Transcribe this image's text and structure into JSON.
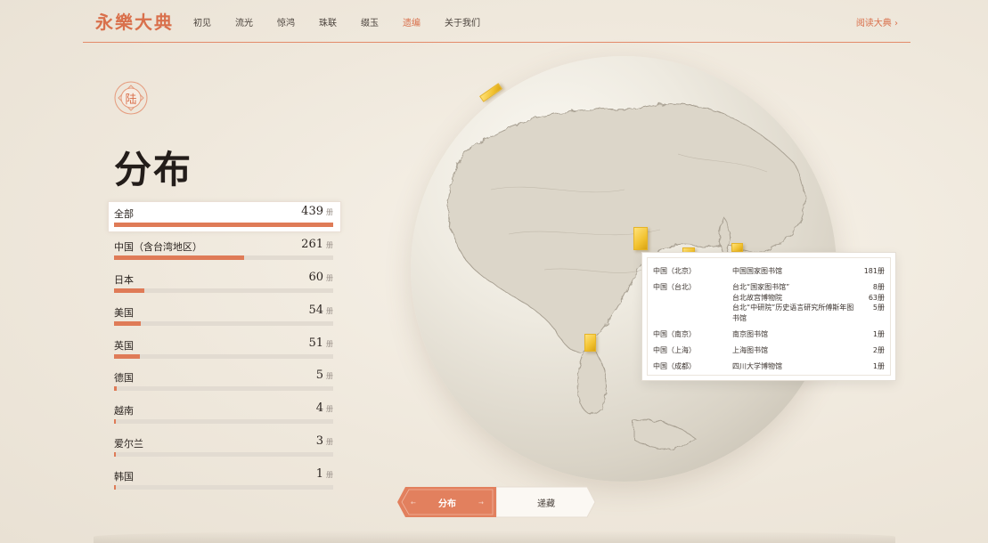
{
  "header": {
    "logo": "永樂大典",
    "nav": [
      {
        "label": "初见",
        "active": false
      },
      {
        "label": "流光",
        "active": false
      },
      {
        "label": "惊鸿",
        "active": false
      },
      {
        "label": "珠联",
        "active": false
      },
      {
        "label": "缀玉",
        "active": false
      },
      {
        "label": "遗编",
        "active": true
      },
      {
        "label": "关于我们",
        "active": false
      }
    ],
    "read_link": "阅读大典 ›"
  },
  "badge": "陆",
  "section_title": "分布",
  "unit": "册",
  "distribution": [
    {
      "name": "全部",
      "count": 439,
      "fraction": 1.0,
      "selected": true
    },
    {
      "name": "中国（含台湾地区）",
      "count": 261,
      "fraction": 0.5945,
      "selected": false
    },
    {
      "name": "日本",
      "count": 60,
      "fraction": 0.1367,
      "selected": false
    },
    {
      "name": "美国",
      "count": 54,
      "fraction": 0.123,
      "selected": false
    },
    {
      "name": "英国",
      "count": 51,
      "fraction": 0.1162,
      "selected": false
    },
    {
      "name": "德国",
      "count": 5,
      "fraction": 0.0114,
      "selected": false
    },
    {
      "name": "越南",
      "count": 4,
      "fraction": 0.0091,
      "selected": false
    },
    {
      "name": "爱尔兰",
      "count": 3,
      "fraction": 0.0068,
      "selected": false
    },
    {
      "name": "韩国",
      "count": 1,
      "fraction": 0.0023,
      "selected": false
    }
  ],
  "info_panel": [
    {
      "region": "中国（北京）",
      "libraries": [
        "中国国家图书馆"
      ],
      "counts": [
        "181册"
      ]
    },
    {
      "region": "中国（台北）",
      "libraries": [
        "台北“国家图书馆”",
        "台北故宫博物院",
        "台北“中研院”历史语言研究所傅斯年图书馆"
      ],
      "counts": [
        "8册",
        "63册",
        "5册"
      ]
    },
    {
      "region": "中国（南京）",
      "libraries": [
        "南京图书馆"
      ],
      "counts": [
        "1册"
      ]
    },
    {
      "region": "中国（上海）",
      "libraries": [
        "上海图书馆"
      ],
      "counts": [
        "2册"
      ]
    },
    {
      "region": "中国（成都）",
      "libraries": [
        "四川大学博物馆"
      ],
      "counts": [
        "1册"
      ]
    }
  ],
  "toggle": {
    "options": [
      {
        "label": "分布",
        "active": true
      },
      {
        "label": "递藏",
        "active": false
      }
    ],
    "accent": "#df7b57"
  },
  "colors": {
    "accent": "#d9704c",
    "bar": "#df7b57",
    "marker": "#f2c230"
  }
}
